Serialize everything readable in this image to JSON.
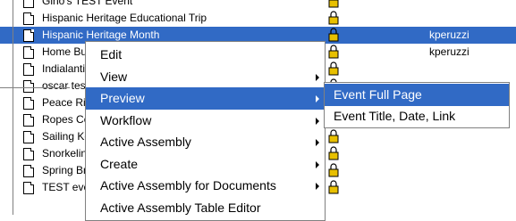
{
  "rows": [
    {
      "title": "Gino's TEST Event",
      "owner": "",
      "selected": false
    },
    {
      "title": "Hispanic Heritage Educational Trip",
      "owner": "",
      "selected": false
    },
    {
      "title": "Hispanic Heritage Month",
      "owner": "kperuzzi",
      "selected": true
    },
    {
      "title": "Home Buy",
      "owner": "kperuzzi",
      "selected": false
    },
    {
      "title": "Indialantic",
      "owner": "",
      "selected": false
    },
    {
      "title": "oscar test",
      "owner": "",
      "selected": false
    },
    {
      "title": "Peace Rive",
      "owner": "",
      "selected": false
    },
    {
      "title": "Ropes Cou",
      "owner": "",
      "selected": false
    },
    {
      "title": "Sailing Key",
      "owner": "",
      "selected": false
    },
    {
      "title": "Snorkeling",
      "owner": "",
      "selected": false
    },
    {
      "title": "Spring Bre",
      "owner": "",
      "selected": false
    },
    {
      "title": "TEST even",
      "owner": "",
      "selected": false
    }
  ],
  "context_menu": {
    "items": [
      {
        "label": "Edit",
        "submenu": false,
        "highlighted": false
      },
      {
        "label": "View",
        "submenu": true,
        "highlighted": false
      },
      {
        "label": "Preview",
        "submenu": true,
        "highlighted": true
      },
      {
        "label": "Workflow",
        "submenu": true,
        "highlighted": false
      },
      {
        "label": "Active Assembly",
        "submenu": true,
        "highlighted": false
      },
      {
        "label": "Create",
        "submenu": true,
        "highlighted": false
      },
      {
        "label": "Active Assembly for Documents",
        "submenu": true,
        "highlighted": false
      },
      {
        "label": "Active Assembly Table Editor",
        "submenu": false,
        "highlighted": false
      }
    ]
  },
  "preview_submenu": {
    "items": [
      {
        "label": "Event Full Page",
        "highlighted": true
      },
      {
        "label": "Event Title, Date, Link",
        "highlighted": false
      }
    ]
  },
  "colors": {
    "selection": "#316AC5",
    "lock": "#E8C000"
  }
}
